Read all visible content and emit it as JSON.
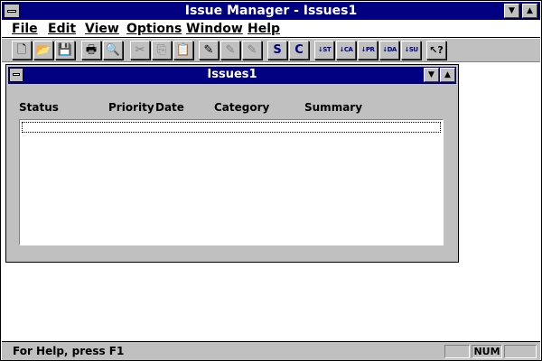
{
  "app": {
    "title": "Issue Manager - Issues1"
  },
  "menu": {
    "items": [
      {
        "label": "File"
      },
      {
        "label": "Edit"
      },
      {
        "label": "View"
      },
      {
        "label": "Options"
      },
      {
        "label": "Window"
      },
      {
        "label": "Help"
      }
    ]
  },
  "toolbar": {
    "buttons": [
      {
        "icon": "new-document-icon",
        "glyph": "🗋"
      },
      {
        "icon": "open-folder-icon",
        "glyph": "📂"
      },
      {
        "icon": "save-disk-icon",
        "glyph": "💾"
      },
      {
        "icon": "print-icon",
        "glyph": "🖶"
      },
      {
        "icon": "print-preview-icon",
        "glyph": "🔍"
      },
      {
        "icon": "cut-icon",
        "glyph": "✂"
      },
      {
        "icon": "copy-icon",
        "glyph": "⎘"
      },
      {
        "icon": "paste-icon",
        "glyph": "📋"
      },
      {
        "icon": "new-issue-icon",
        "glyph": "✎"
      },
      {
        "icon": "edit-issue-icon",
        "glyph": "✎"
      },
      {
        "icon": "delete-issue-icon",
        "glyph": "✎"
      },
      {
        "icon": "summary-report-icon",
        "glyph": "S"
      },
      {
        "icon": "category-report-icon",
        "glyph": "C"
      },
      {
        "icon": "sort-status-icon",
        "glyph": "↓ST"
      },
      {
        "icon": "sort-category-icon",
        "glyph": "↓CA"
      },
      {
        "icon": "sort-priority-icon",
        "glyph": "↓PR"
      },
      {
        "icon": "sort-date-icon",
        "glyph": "↓DA"
      },
      {
        "icon": "sort-summary-icon",
        "glyph": "↓SU"
      },
      {
        "icon": "context-help-icon",
        "glyph": "↖?"
      }
    ]
  },
  "child_window": {
    "title": "Issues1",
    "columns": [
      {
        "label": "Status"
      },
      {
        "label": "Priority"
      },
      {
        "label": "Date"
      },
      {
        "label": "Category"
      },
      {
        "label": "Summary"
      }
    ]
  },
  "status_bar": {
    "help_text": "For Help, press F1",
    "num_indicator": "NUM"
  },
  "colors": {
    "title_bar": "#000080",
    "face": "#c0c0c0",
    "workspace": "#ffffff"
  }
}
